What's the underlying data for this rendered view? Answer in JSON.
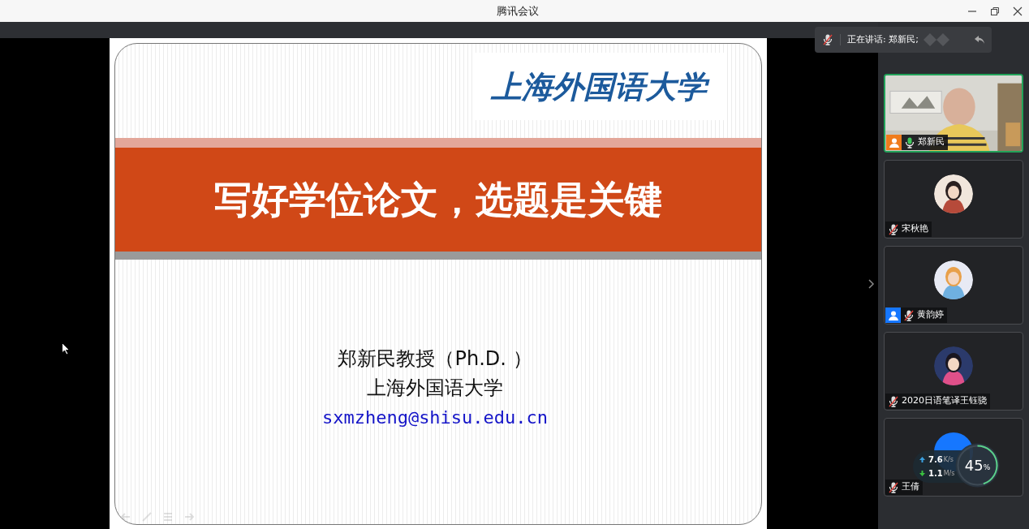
{
  "window": {
    "title": "腾讯会议"
  },
  "speaking": {
    "label": "正在讲话: 郑新民;",
    "muted": true
  },
  "slide": {
    "logo": "上海外国语大学",
    "title": "写好学位论文，选题是关键",
    "lines": [
      "郑新民教授（Ph.D. ）",
      "上海外国语大学"
    ],
    "email": "sxmzheng@shisu.edu.cn"
  },
  "participants": [
    {
      "name": "郑新民",
      "mic_on": true,
      "color": "#f07c1c",
      "kind": "video",
      "selected": true
    },
    {
      "name": "宋秋艳",
      "mic_on": false,
      "kind": "avatar",
      "selected": false
    },
    {
      "name": "黄韵婷",
      "mic_on": false,
      "color": "#1677ff",
      "kind": "avatar",
      "selected": false
    },
    {
      "name": "2020日语笔译王钰骁",
      "mic_on": false,
      "kind": "avatar",
      "selected": false
    },
    {
      "name": "王倩",
      "mic_on": false,
      "kind": "initials",
      "selected": false
    }
  ],
  "network": {
    "upload": "7.6",
    "upload_unit": "K/s",
    "download": "1.1",
    "download_unit": "M/s",
    "percent": "45",
    "percent_unit": "%",
    "level": 0.45
  }
}
